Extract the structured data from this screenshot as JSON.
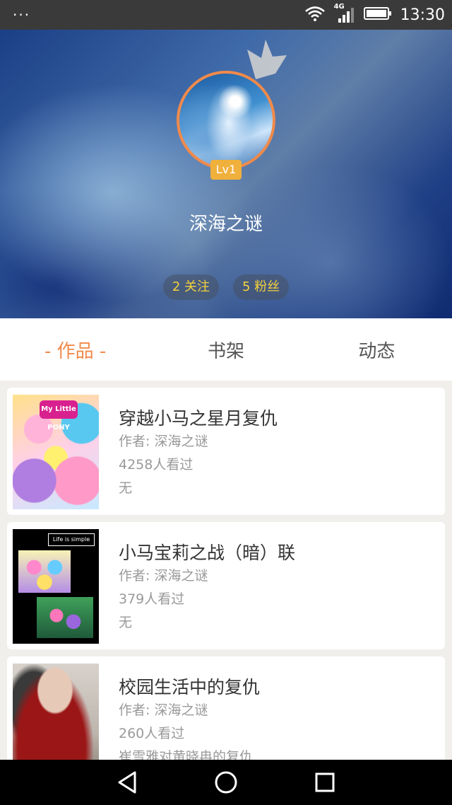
{
  "status_bar": {
    "menu_dots": "···",
    "network_label": "4G",
    "time": "13:30"
  },
  "profile": {
    "username": "深海之谜",
    "level": "Lv1",
    "following": "2 关注",
    "followers": "5 粉丝"
  },
  "tabs": [
    {
      "label": "- 作品 -",
      "active": true
    },
    {
      "label": "书架",
      "active": false
    },
    {
      "label": "动态",
      "active": false
    }
  ],
  "works": [
    {
      "title": "穿越小马之星月复仇",
      "author": "作者: 深海之谜",
      "views": "4258人看过",
      "description": "无",
      "cover_text": "My Little PONY"
    },
    {
      "title": "小马宝莉之战（暗）联",
      "author": "作者: 深海之谜",
      "views": "379人看过",
      "description": "无",
      "cover_text": "Life is simple"
    },
    {
      "title": "校园生活中的复仇",
      "author": "作者: 深海之谜",
      "views": "260人看过",
      "description": "崔雪雅对黄晓冉的复仇"
    }
  ],
  "colors": {
    "accent": "#f08a4b",
    "stat_text": "#f5d13c",
    "level_badge": "#f0b03c"
  }
}
